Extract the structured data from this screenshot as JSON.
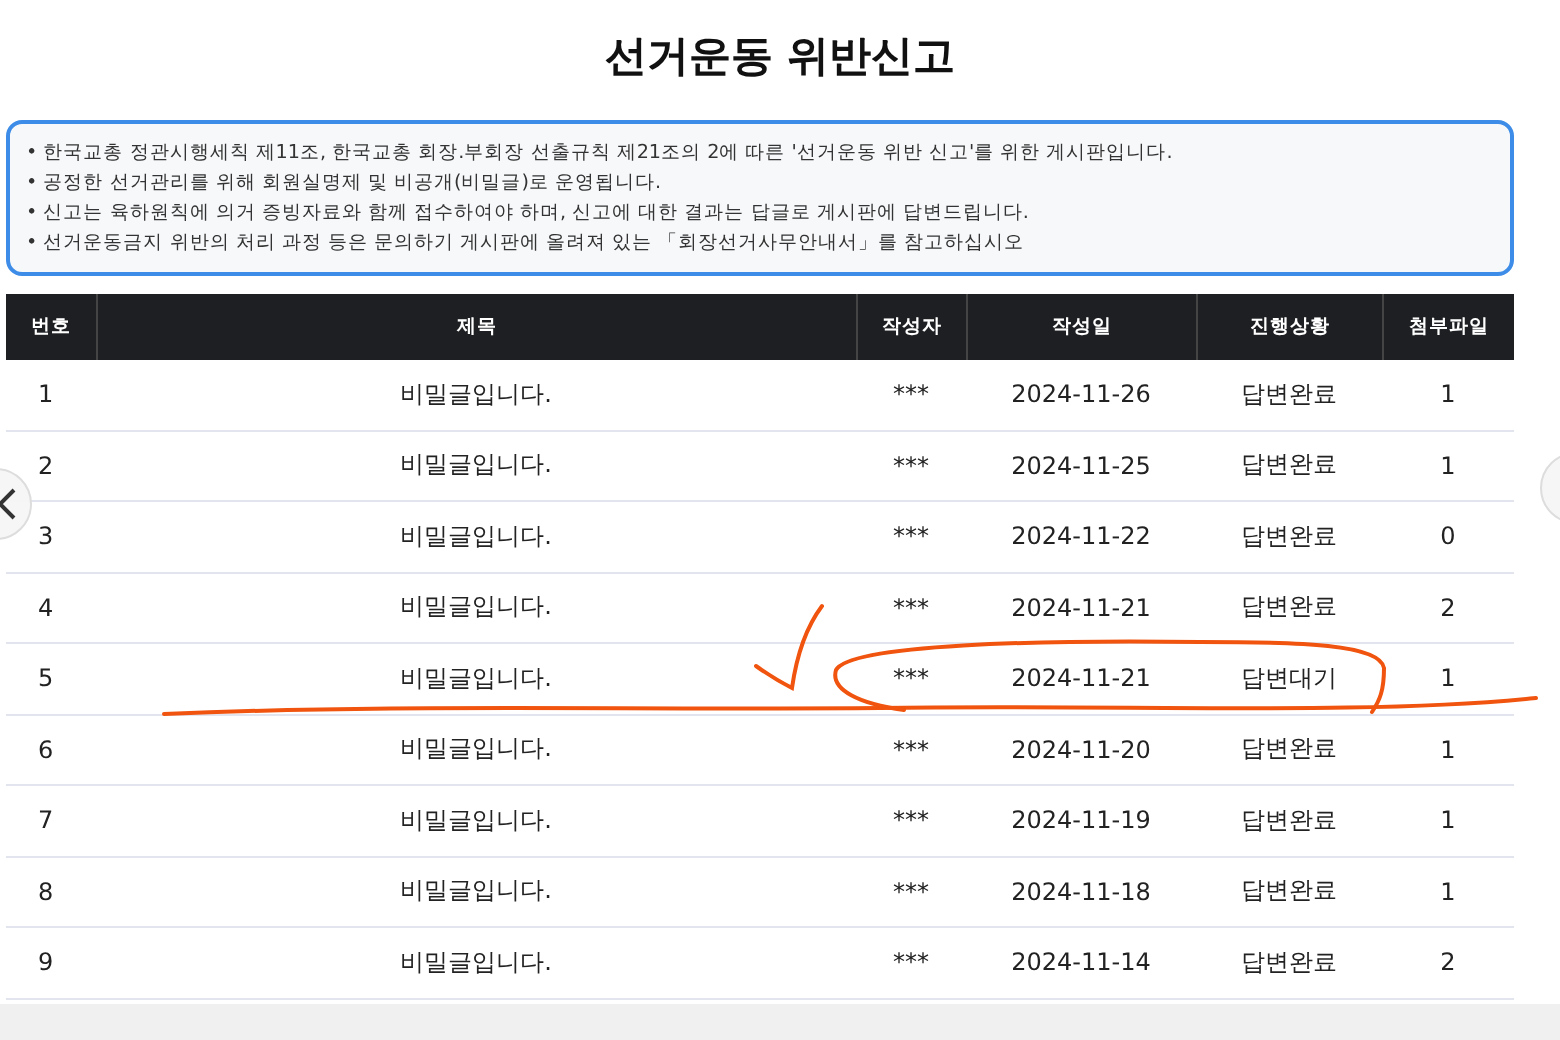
{
  "title": "선거운동 위반신고",
  "notice": [
    "• 한국교총 정관시행세칙 제11조, 한국교총 회장.부회장 선출규칙 제21조의 2에 따른 '선거운동 위반 신고'를 위한 게시판입니다.",
    "• 공정한 선거관리를 위해 회원실명제 및 비공개(비밀글)로 운영됩니다.",
    "• 신고는 육하원칙에 의거 증빙자료와 함께 접수하여야 하며, 신고에 대한 결과는 답글로 게시판에 답변드립니다.",
    "• 선거운동금지 위반의 처리 과정 등은 문의하기 게시판에 올려져 있는 「회장선거사무안내서」를 참고하십시오"
  ],
  "table": {
    "columns": [
      "번호",
      "제목",
      "작성자",
      "작성일",
      "진행상황",
      "첨부파일"
    ],
    "rows": [
      {
        "cells": [
          "1",
          "비밀글입니다.",
          "***",
          "2024-11-26",
          "답변완료",
          "1"
        ]
      },
      {
        "cells": [
          "2",
          "비밀글입니다.",
          "***",
          "2024-11-25",
          "답변완료",
          "1"
        ]
      },
      {
        "cells": [
          "3",
          "비밀글입니다.",
          "***",
          "2024-11-22",
          "답변완료",
          "0"
        ]
      },
      {
        "cells": [
          "4",
          "비밀글입니다.",
          "***",
          "2024-11-21",
          "답변완료",
          "2"
        ]
      },
      {
        "cells": [
          "5",
          "비밀글입니다.",
          "***",
          "2024-11-21",
          "답변대기",
          "1"
        ]
      },
      {
        "cells": [
          "6",
          "비밀글입니다.",
          "***",
          "2024-11-20",
          "답변완료",
          "1"
        ]
      },
      {
        "cells": [
          "7",
          "비밀글입니다.",
          "***",
          "2024-11-19",
          "답변완료",
          "1"
        ]
      },
      {
        "cells": [
          "8",
          "비밀글입니다.",
          "***",
          "2024-11-18",
          "답변완료",
          "1"
        ]
      },
      {
        "cells": [
          "9",
          "비밀글입니다.",
          "***",
          "2024-11-14",
          "답변완료",
          "2"
        ]
      }
    ]
  }
}
